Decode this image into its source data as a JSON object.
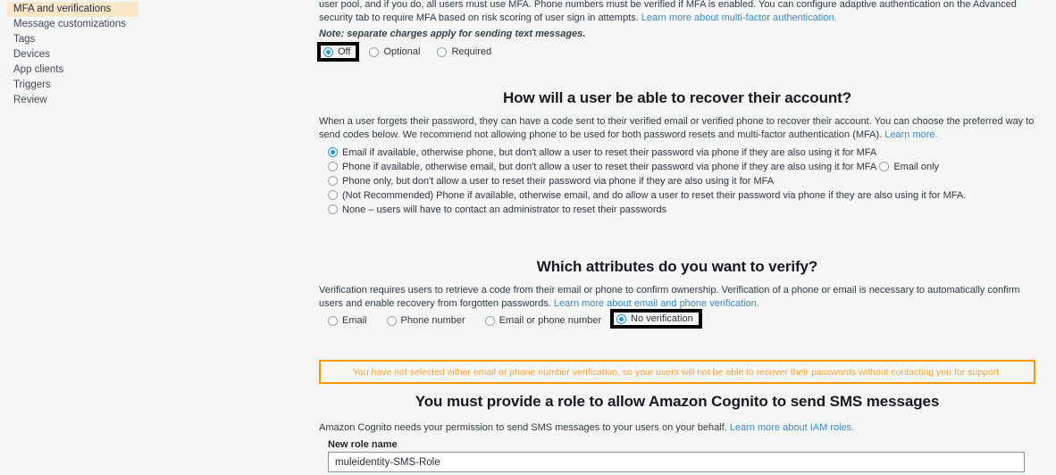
{
  "sidebar": {
    "items": [
      {
        "label": "MFA and verifications",
        "active": true
      },
      {
        "label": "Message customizations",
        "active": false
      },
      {
        "label": "Tags",
        "active": false
      },
      {
        "label": "Devices",
        "active": false
      },
      {
        "label": "App clients",
        "active": false
      },
      {
        "label": "Triggers",
        "active": false
      },
      {
        "label": "Review",
        "active": false
      }
    ]
  },
  "mfa": {
    "intro_line1": "user pool, and if you do, all users must use MFA. Phone numbers must be verified if MFA is enabled. You can configure adaptive authentication on the Advanced security tab to require MFA",
    "intro_line2": "based on risk scoring of user sign in attempts.",
    "intro_link": "Learn more about multi-factor authentication.",
    "note": "Note: separate charges apply for sending text messages.",
    "options": [
      {
        "label": "Off",
        "checked": true,
        "focused": true
      },
      {
        "label": "Optional",
        "checked": false,
        "focused": false
      },
      {
        "label": "Required",
        "checked": false,
        "focused": false
      }
    ]
  },
  "recovery": {
    "heading": "How will a user be able to recover their account?",
    "description": "When a user forgets their password, they can have a code sent to their verified email or verified phone to recover their account. You can choose the preferred way to send codes below. We recommend not allowing phone to be used for both password resets and multi-factor authentication (MFA).",
    "description_link": "Learn more.",
    "options": [
      {
        "label": "Email if available, otherwise phone, but don't allow a user to reset their password via phone if they are also using it for MFA",
        "checked": true
      },
      {
        "label": "Phone if available, otherwise email, but don't allow a user to reset their password via phone if they are also using it for MFA",
        "checked": false
      },
      {
        "label": "Email only",
        "checked": false
      },
      {
        "label": "Phone only, but don't allow a user to reset their password via phone if they are also using it for MFA",
        "checked": false
      },
      {
        "label": "(Not Recommended) Phone if available, otherwise email, and do allow a user to reset their password via phone if they are also using it for MFA.",
        "checked": false
      },
      {
        "label": "None – users will have to contact an administrator to reset their passwords",
        "checked": false
      }
    ]
  },
  "verification": {
    "heading": "Which attributes do you want to verify?",
    "description": "Verification requires users to retrieve a code from their email or phone to confirm ownership. Verification of a phone or email is necessary to automatically confirm users and enable recovery from forgotten passwords.",
    "description_link": "Learn more about email and phone verification.",
    "options": [
      {
        "label": "Email",
        "checked": false,
        "focused": false
      },
      {
        "label": "Phone number",
        "checked": false,
        "focused": false
      },
      {
        "label": "Email or phone number",
        "checked": false,
        "focused": false
      },
      {
        "label": "No verification",
        "checked": true,
        "focused": true
      }
    ]
  },
  "warning": {
    "text": "You have not selected either email or phone number verification, so your users will not be able to recover their passwords without contacting you for support.",
    "border_color": "#f79400",
    "text_color": "#f5a23c"
  },
  "sms_role": {
    "heading": "You must provide a role to allow Amazon Cognito to send SMS messages",
    "description": "Amazon Cognito needs your permission to send SMS messages to your users on your behalf.",
    "description_link": "Learn more about IAM roles.",
    "field_label": "New role name",
    "field_value": "muleidentity-SMS-Role",
    "field_placeholder": "New role name"
  },
  "colors": {
    "page_bg": "#f4f5f5",
    "active_nav_bg": "#fae6c8",
    "link": "#3b8cc4",
    "radio_accent": "#1f9ad6"
  }
}
